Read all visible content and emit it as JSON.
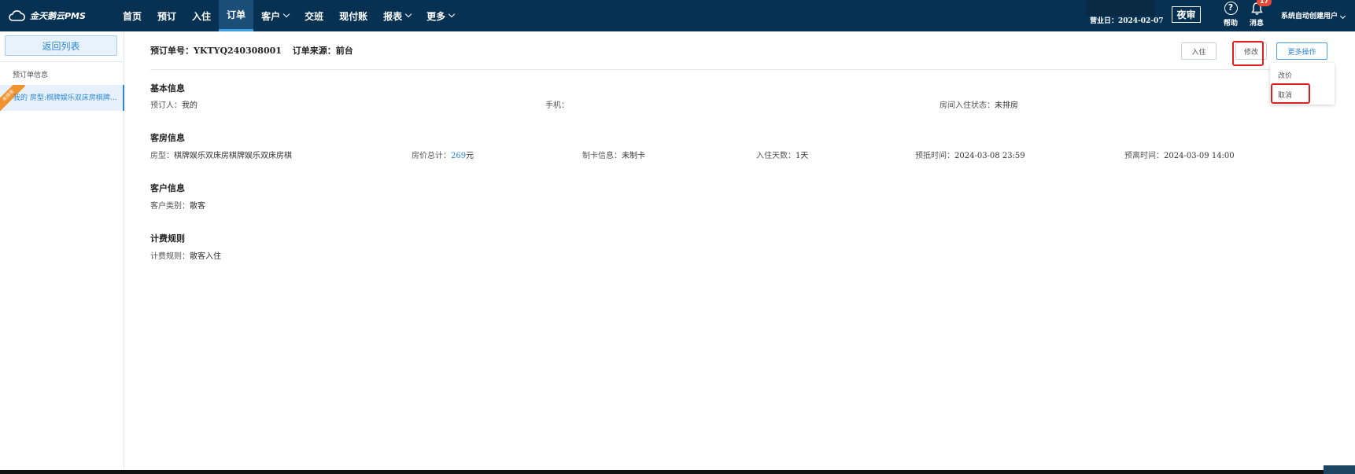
{
  "app": {
    "logo_text": "金天鹅云PMS"
  },
  "nav": [
    {
      "label": "首页",
      "dropdown": false,
      "active": false
    },
    {
      "label": "预订",
      "dropdown": false,
      "active": false
    },
    {
      "label": "入住",
      "dropdown": false,
      "active": false
    },
    {
      "label": "订单",
      "dropdown": false,
      "active": true
    },
    {
      "label": "客户",
      "dropdown": true,
      "active": false
    },
    {
      "label": "交班",
      "dropdown": false,
      "active": false
    },
    {
      "label": "现付账",
      "dropdown": false,
      "active": false
    },
    {
      "label": "报表",
      "dropdown": true,
      "active": false
    },
    {
      "label": "更多",
      "dropdown": true,
      "active": false
    }
  ],
  "topbar": {
    "business_date": "营业日：2024-02-07",
    "night_audit": "夜审",
    "help_label": "帮助",
    "messages_label": "消息",
    "messages_badge": "17",
    "username": "系统自动创建用户"
  },
  "sidebar": {
    "back_label": "返回列表",
    "section_label": "预订单信息",
    "item_label": "我的  房型:棋牌娱乐双床房棋牌娱乐双床房棋",
    "item_ribbon": "未排房"
  },
  "order": {
    "number_label": "预订单号：YKTYQ240308001",
    "source_label": "订单来源：前台"
  },
  "actions": {
    "checkin": "入住",
    "modify": "修改",
    "more": "更多操作",
    "dropdown": [
      "改价",
      "取消"
    ]
  },
  "basic": {
    "title": "基本信息",
    "booker_label": "预订人：",
    "booker_value": "我的",
    "phone_label": "手机：",
    "phone_value": "",
    "status_label": "房间入住状态：",
    "status_value": "未排房"
  },
  "room": {
    "title": "客房信息",
    "type_label": "房型：",
    "type_value": "棋牌娱乐双床房棋牌娱乐双床房棋",
    "price_label": "房价总计：",
    "price_value": "269",
    "price_unit": "元",
    "card_label": "制卡信息：",
    "card_value": "未制卡",
    "days_label": "入住天数：",
    "days_value": "1天",
    "arrive_label": "预抵时间：",
    "arrive_value": "2024-03-08 23:59",
    "depart_label": "预离时间：",
    "depart_value": "2024-03-09 14:00"
  },
  "customer": {
    "title": "客户信息",
    "category_label": "客户类别：",
    "category_value": "散客"
  },
  "billing": {
    "title": "计费规则",
    "rule_label": "计费规则：",
    "rule_value": "散客入住"
  },
  "colors": {
    "topbar": "#063152",
    "accent": "#2f86d6",
    "highlight": "#e02020",
    "ribbon": "#f0922e"
  }
}
